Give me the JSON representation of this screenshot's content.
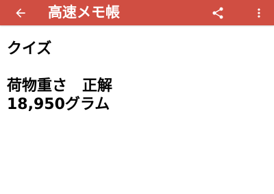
{
  "toolbar": {
    "title": "高速メモ帳",
    "color": "#d04e42",
    "icons": [
      "arrow-left-icon",
      "share-icon",
      "more-vert-icon"
    ]
  },
  "memo": {
    "line1": "クイズ",
    "line2": "",
    "line3": "荷物重さ　正解",
    "line4": "18,950グラム"
  }
}
